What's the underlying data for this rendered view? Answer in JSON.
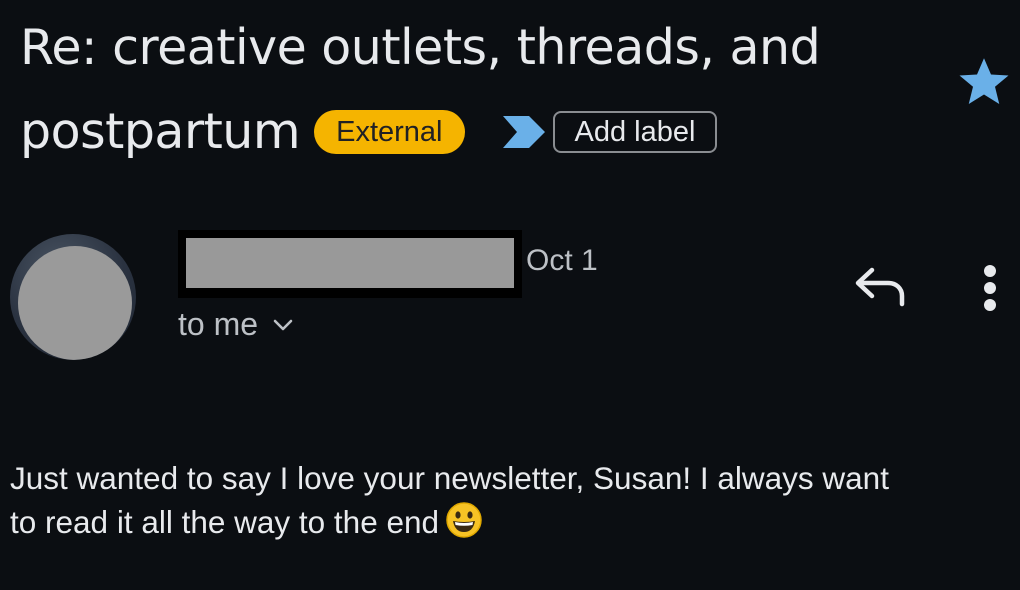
{
  "email": {
    "subject_line1": "Re: creative outlets, threads, and",
    "subject_line2": "postpartum",
    "badge_external": "External",
    "add_label": "Add label",
    "date": "Oct 1",
    "recipient": "to me",
    "body_line1": "Just wanted to say I love your newsletter, Susan! I always want",
    "body_line2": "to read it all the way to the end",
    "starred": true
  },
  "icons": {
    "star": "star-icon",
    "label_chevron": "label-chevron-icon",
    "reply": "reply-icon",
    "more": "more-vert-icon",
    "recipient_expand": "chevron-down-icon",
    "emoji": "grinning-face-emoji"
  },
  "colors": {
    "background": "#0b0e12",
    "external_badge": "#f5b400",
    "star": "#6ab0e8",
    "label_chevron": "#6ab0e8"
  }
}
